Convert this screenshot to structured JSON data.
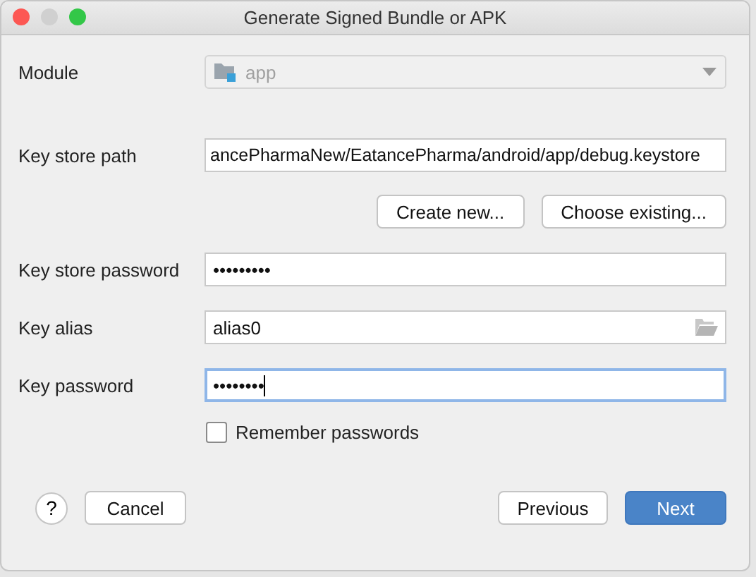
{
  "window": {
    "title": "Generate Signed Bundle or APK"
  },
  "module": {
    "label": "Module",
    "value": "app",
    "disabled": true
  },
  "key_store_path": {
    "label": "Key store path",
    "value": "ancePharmaNew/EatancePharma/android/app/debug.keystore"
  },
  "key_store_buttons": [
    "Create new...",
    "Choose existing..."
  ],
  "fields": [
    {
      "label": "Key store password",
      "value": "•••••••••",
      "kind": "password",
      "focused": false
    },
    {
      "label": "Key alias",
      "value": "alias0",
      "kind": "browse",
      "focused": false
    },
    {
      "label": "Key password",
      "value": "••••••••",
      "kind": "password",
      "focused": true
    }
  ],
  "remember_passwords": {
    "label": "Remember passwords",
    "checked": false
  },
  "help": "?",
  "buttons": {
    "cancel": "Cancel",
    "previous": "Previous",
    "next": "Next"
  }
}
